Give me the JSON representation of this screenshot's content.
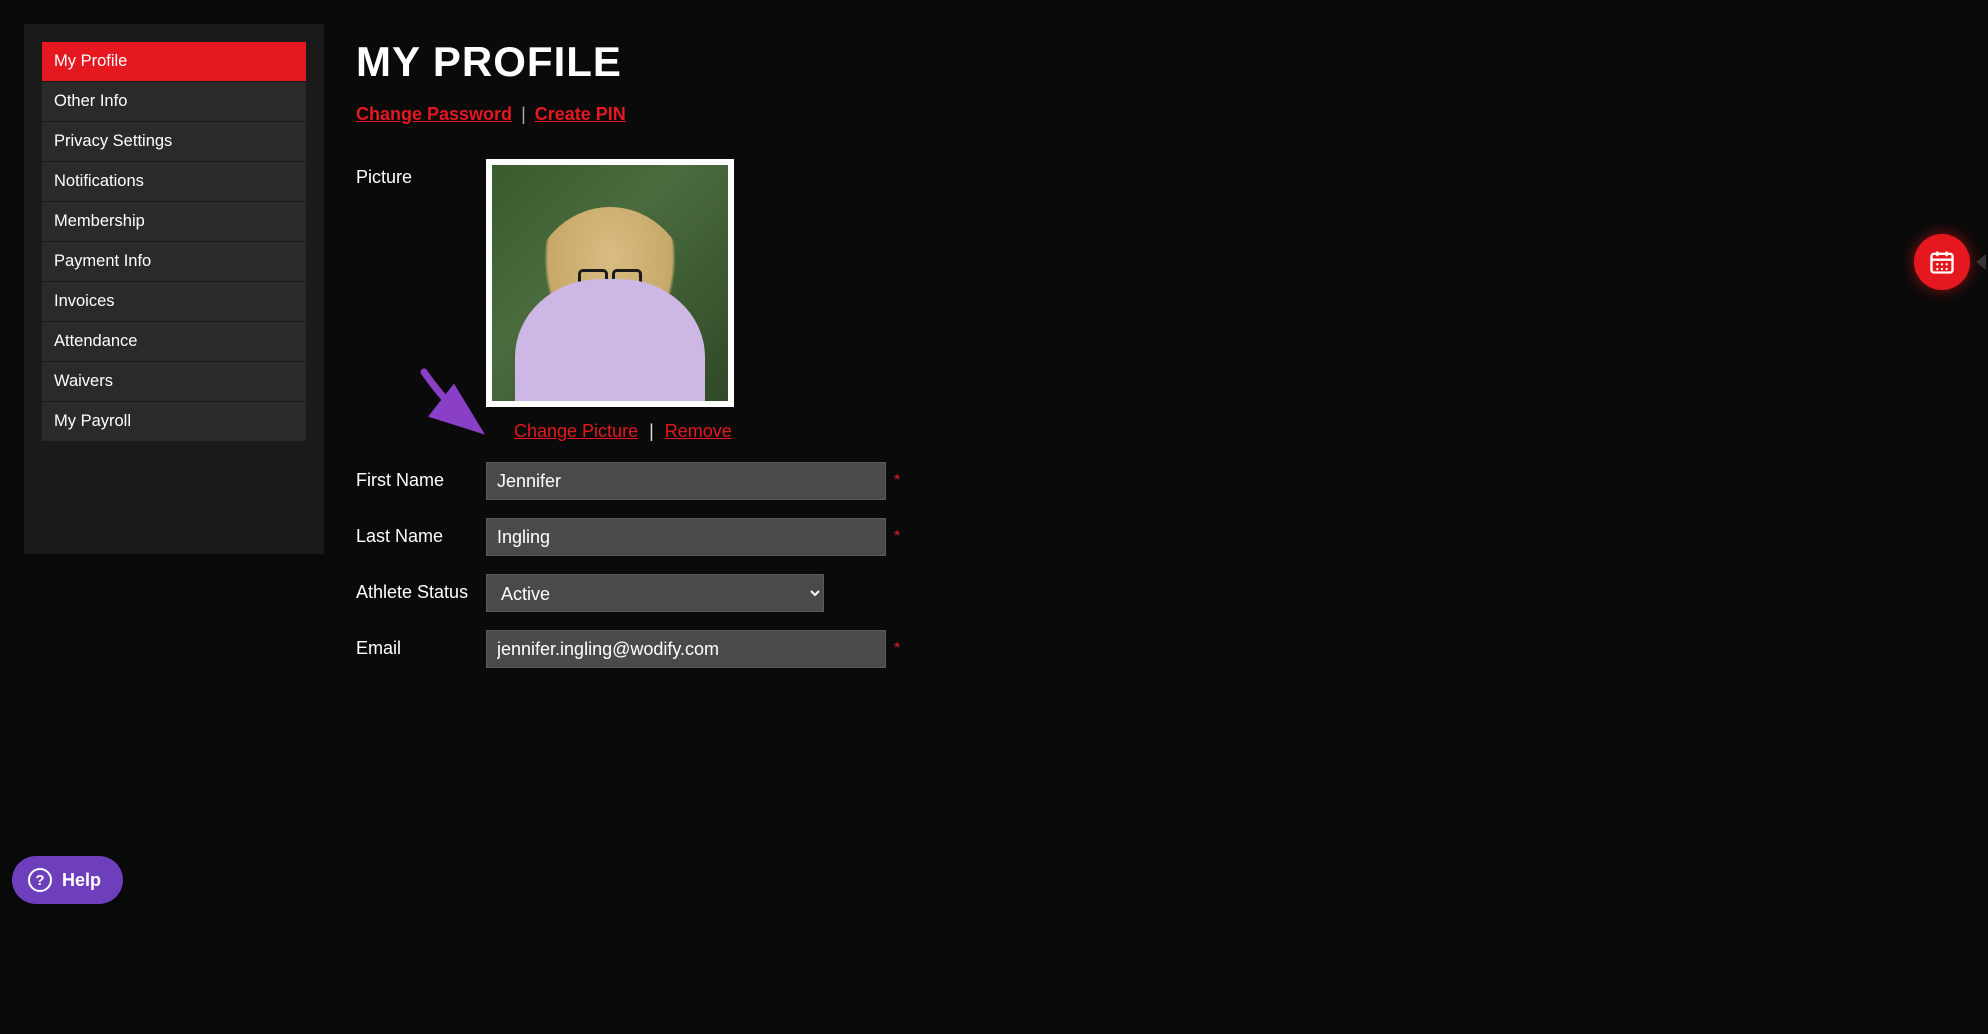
{
  "sidebar": {
    "items": [
      {
        "label": "My Profile",
        "active": true
      },
      {
        "label": "Other Info",
        "active": false
      },
      {
        "label": "Privacy Settings",
        "active": false
      },
      {
        "label": "Notifications",
        "active": false
      },
      {
        "label": "Membership",
        "active": false
      },
      {
        "label": "Payment Info",
        "active": false
      },
      {
        "label": "Invoices",
        "active": false
      },
      {
        "label": "Attendance",
        "active": false
      },
      {
        "label": "Waivers",
        "active": false
      },
      {
        "label": "My Payroll",
        "active": false
      }
    ]
  },
  "header": {
    "title": "MY PROFILE",
    "links": {
      "change_password": "Change Password",
      "create_pin": "Create PIN",
      "sep": "|"
    }
  },
  "picture": {
    "label": "Picture",
    "change_label": "Change Picture",
    "remove_label": "Remove",
    "sep": "|"
  },
  "form": {
    "first_name": {
      "label": "First Name",
      "value": "Jennifer",
      "required": "*"
    },
    "last_name": {
      "label": "Last Name",
      "value": "Ingling",
      "required": "*"
    },
    "athlete_status": {
      "label": "Athlete Status",
      "value": "Active"
    },
    "email": {
      "label": "Email",
      "value": "jennifer.ingling@wodify.com",
      "required": "*"
    }
  },
  "help": {
    "label": "Help"
  }
}
